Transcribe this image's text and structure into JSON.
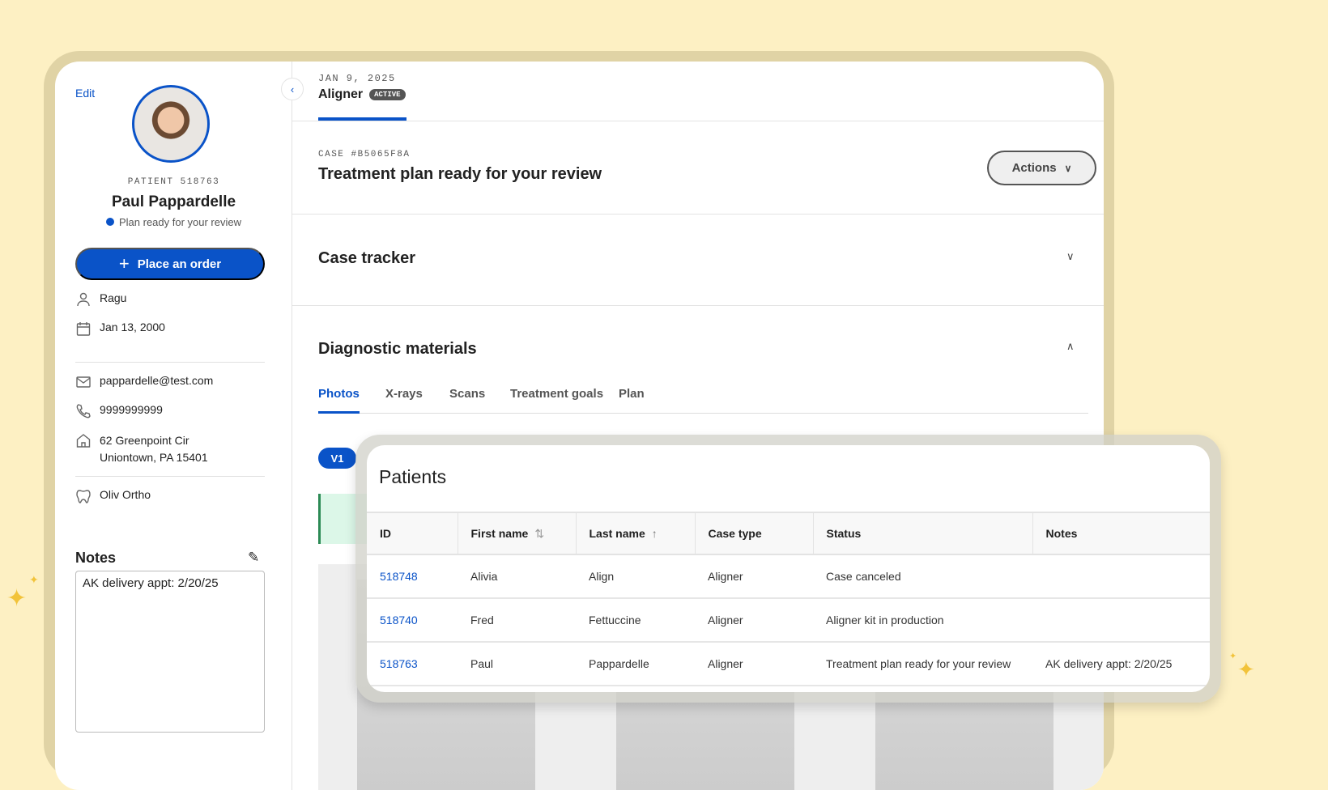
{
  "sidebar": {
    "edit_label": "Edit",
    "patient_label": "PATIENT 518763",
    "name": "Paul Pappardelle",
    "status": "Plan ready for your review",
    "status_color": "#0a53c8",
    "order_button": "Place an order",
    "preferred_name": "Ragu",
    "dob": "Jan 13, 2000",
    "email": "pappardelle@test.com",
    "phone": "9999999999",
    "address_line1": "62 Greenpoint Cir",
    "address_line2": "Uniontown, PA 15401",
    "practice": "Oliv Ortho",
    "notes_title": "Notes",
    "notes_value": "AK delivery appt: 2/20/25"
  },
  "header": {
    "date": "JAN 9, 2025",
    "case_type": "Aligner",
    "badge": "ACTIVE"
  },
  "case": {
    "label": "CASE #B5065F8A",
    "title": "Treatment plan ready for your review",
    "actions_label": "Actions"
  },
  "tracker": {
    "title": "Case tracker"
  },
  "diagnostics": {
    "title": "Diagnostic materials",
    "tabs": [
      "Photos",
      "X-rays",
      "Scans",
      "Treatment goals",
      "Plan"
    ],
    "version": "V1"
  },
  "patients": {
    "title": "Patients",
    "columns": [
      "ID",
      "First name",
      "Last name",
      "Case type",
      "Status",
      "Notes"
    ],
    "rows": [
      [
        "518748",
        "Alivia",
        "Align",
        "Aligner",
        "Case canceled",
        ""
      ],
      [
        "518740",
        "Fred",
        "Fettuccine",
        "Aligner",
        "Aligner kit in production",
        ""
      ],
      [
        "518763",
        "Paul",
        "Pappardelle",
        "Aligner",
        "Treatment plan ready for your review",
        "AK delivery appt: 2/20/25"
      ]
    ]
  }
}
